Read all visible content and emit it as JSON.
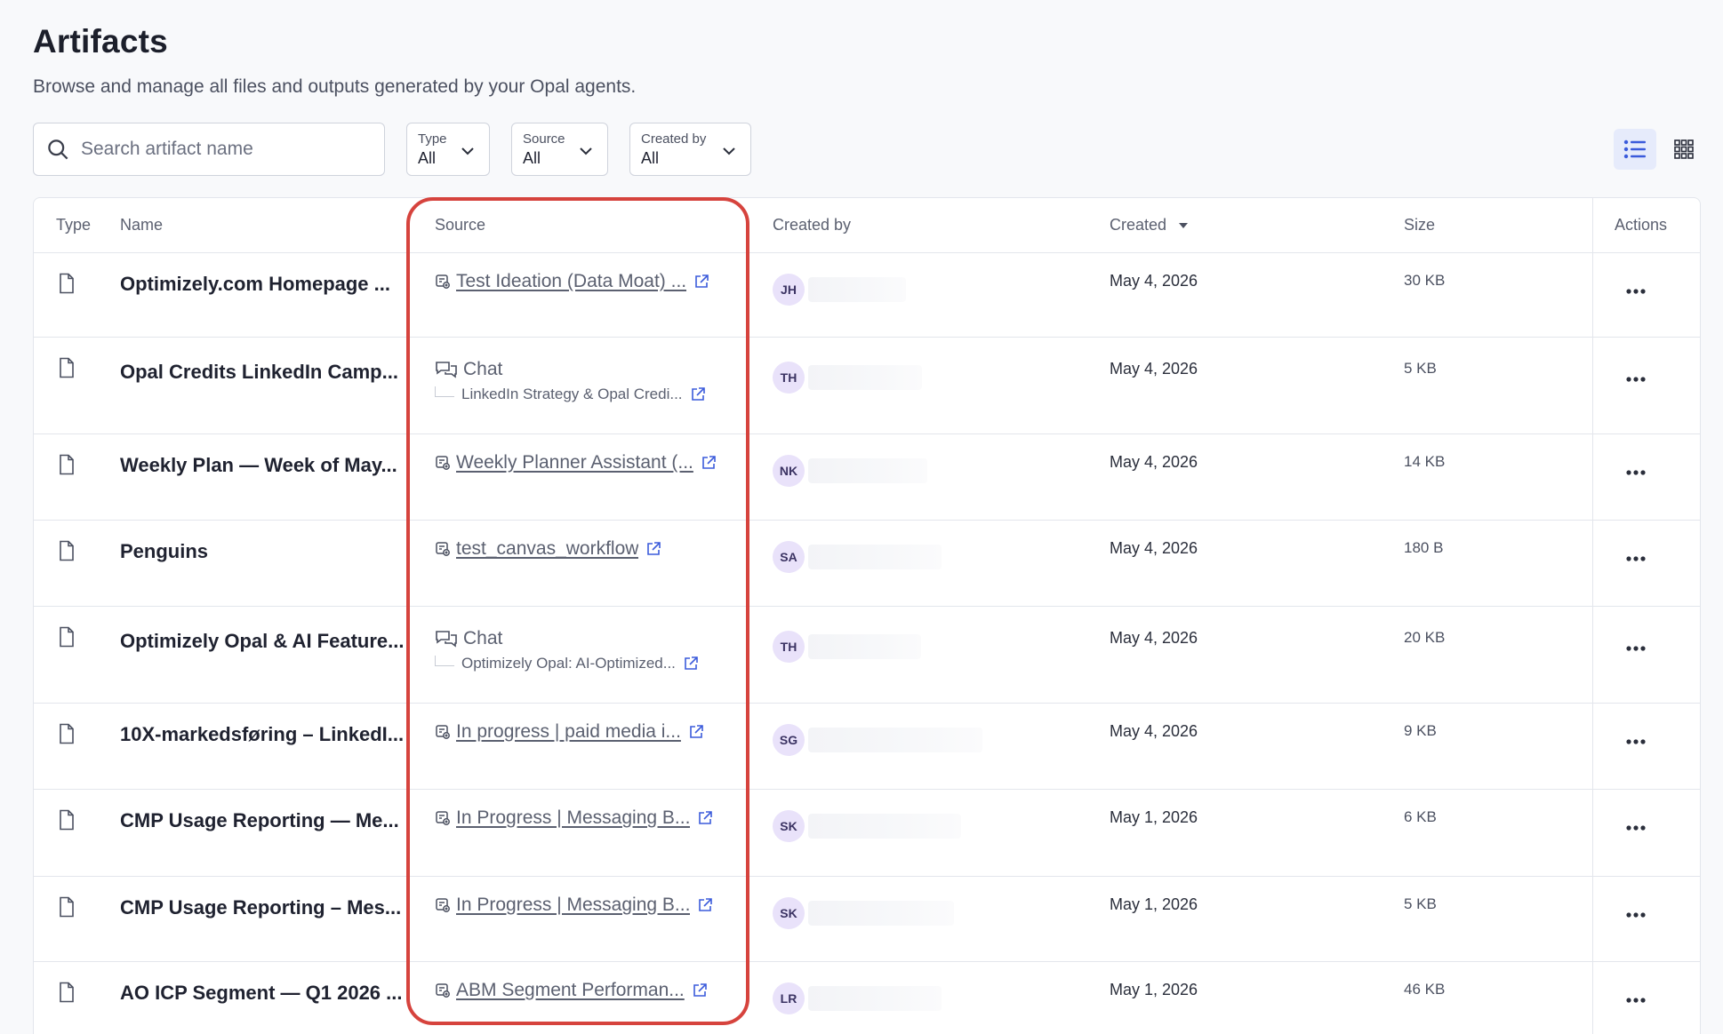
{
  "page": {
    "title": "Artifacts",
    "subtitle": "Browse and manage all files and outputs generated by your Opal agents."
  },
  "toolbar": {
    "search_placeholder": "Search artifact name",
    "filters": [
      {
        "label": "Type",
        "value": "All"
      },
      {
        "label": "Source",
        "value": "All"
      },
      {
        "label": "Created by",
        "value": "All"
      }
    ],
    "view_modes": [
      "list-view-icon",
      "grid-view-icon"
    ],
    "active_view": "list"
  },
  "table": {
    "columns": {
      "type": "Type",
      "name": "Name",
      "source": "Source",
      "created_by": "Created by",
      "created": "Created",
      "size": "Size",
      "actions": "Actions"
    },
    "sort": {
      "column": "Created",
      "direction": "desc"
    },
    "rows": [
      {
        "name": "Optimizely.com Homepage ...",
        "source_kind": "workflow",
        "source": "Test Ideation (Data Moat) ...",
        "initials": "JH",
        "created": "May 4, 2026",
        "size": "30 KB"
      },
      {
        "name": "Opal Credits LinkedIn Camp...",
        "source_kind": "chat",
        "source": "Chat",
        "source_sub": "LinkedIn Strategy & Opal Credi...",
        "initials": "TH",
        "created": "May 4, 2026",
        "size": "5 KB"
      },
      {
        "name": "Weekly Plan — Week of May...",
        "source_kind": "workflow",
        "source": "Weekly Planner Assistant (...",
        "initials": "NK",
        "created": "May 4, 2026",
        "size": "14 KB"
      },
      {
        "name": "Penguins",
        "source_kind": "workflow",
        "source": "test_canvas_workflow",
        "initials": "SA",
        "created": "May 4, 2026",
        "size": "180 B"
      },
      {
        "name": "Optimizely Opal & AI Feature...",
        "source_kind": "chat",
        "source": "Chat",
        "source_sub": "Optimizely Opal: AI-Optimized...",
        "initials": "TH",
        "created": "May 4, 2026",
        "size": "20 KB"
      },
      {
        "name": "10X-markedsføring – LinkedI...",
        "source_kind": "workflow",
        "source": "In progress | paid media i...",
        "initials": "SG",
        "created": "May 4, 2026",
        "size": "9 KB"
      },
      {
        "name": "CMP Usage Reporting — Me...",
        "source_kind": "workflow",
        "source": "In Progress | Messaging B...",
        "initials": "SK",
        "created": "May 1, 2026",
        "size": "6 KB"
      },
      {
        "name": "CMP Usage Reporting – Mes...",
        "source_kind": "workflow",
        "source": "In Progress | Messaging B...",
        "initials": "SK",
        "created": "May 1, 2026",
        "size": "5 KB"
      },
      {
        "name": "AO ICP Segment — Q1 2026 ...",
        "source_kind": "workflow",
        "source": "ABM Segment Performan...",
        "initials": "LR",
        "created": "May 1, 2026",
        "size": "46 KB"
      }
    ]
  },
  "colors": {
    "accent": "#3b5bdb",
    "highlight": "#d6433d",
    "avatar_bg": "#e9e2fa"
  }
}
